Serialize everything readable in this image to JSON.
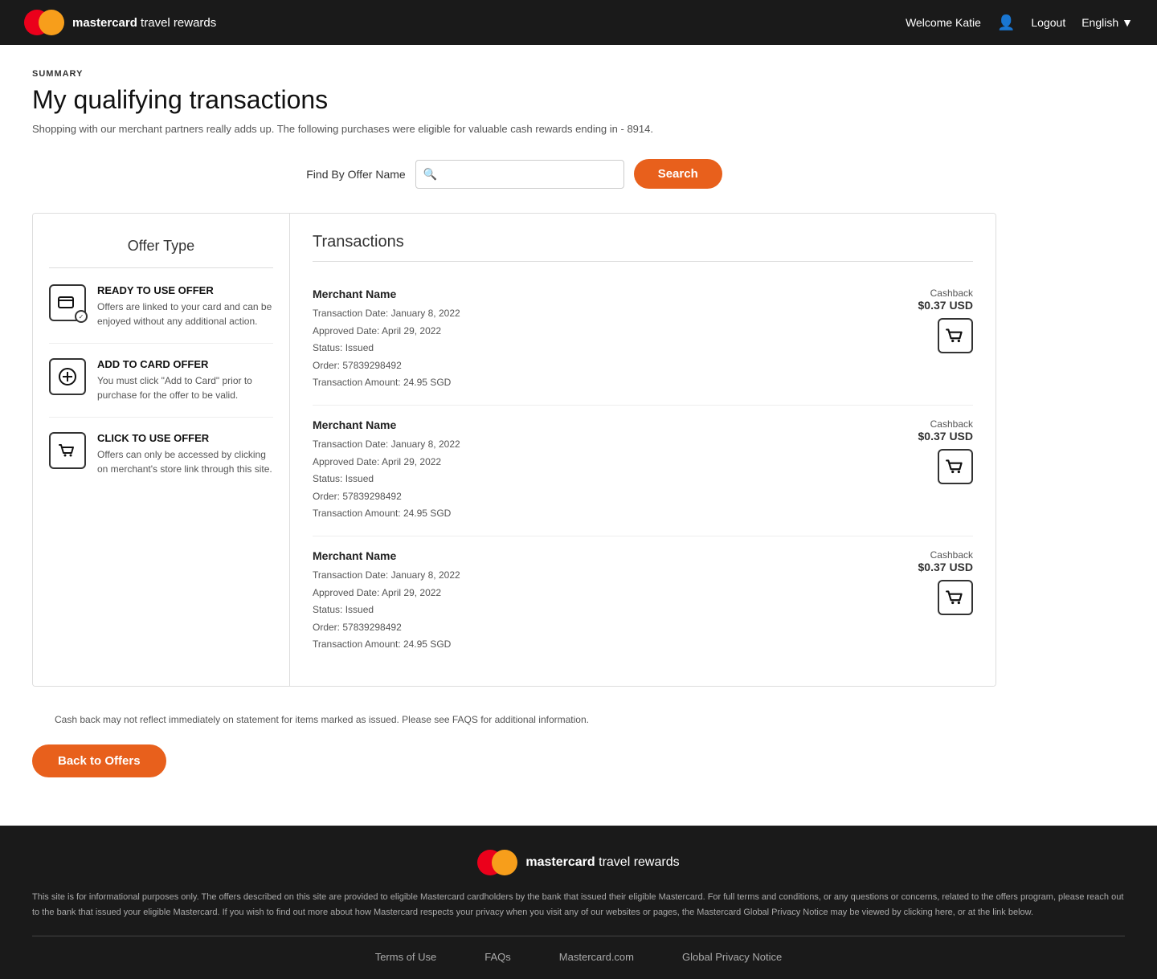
{
  "header": {
    "brand": "mastercard",
    "brand_suffix": " travel rewards",
    "welcome_text": "Welcome Katie",
    "logout_label": "Logout",
    "language_label": "English"
  },
  "page": {
    "summary_label": "SUMMARY",
    "title": "My qualifying transactions",
    "subtitle": "Shopping with our merchant partners really adds up. The following purchases were eligible for valuable cash rewards ending in - 8914."
  },
  "search": {
    "label": "Find By Offer Name",
    "placeholder": "",
    "button_label": "Search"
  },
  "offer_types": {
    "title": "Offer Type",
    "items": [
      {
        "name": "READY TO USE OFFER",
        "description": "Offers are linked to your card and can be enjoyed without any additional action.",
        "icon_type": "card-check"
      },
      {
        "name": "ADD TO CARD OFFER",
        "description": "You must click \"Add to Card\" prior to purchase for the offer to be valid.",
        "icon_type": "plus-circle"
      },
      {
        "name": "CLICK TO USE OFFER",
        "description": "Offers can only be accessed by clicking on merchant's store link through this site.",
        "icon_type": "cart"
      }
    ]
  },
  "transactions": {
    "title": "Transactions",
    "items": [
      {
        "merchant": "Merchant Name",
        "transaction_date": "Transaction Date: January 8, 2022",
        "approved_date": "Approved Date: April 29, 2022",
        "status": "Status: Issued",
        "order": "Order: 57839298492",
        "amount": "Transaction Amount: 24.95 SGD",
        "cashback_label": "Cashback",
        "cashback_amount": "$0.37 USD"
      },
      {
        "merchant": "Merchant Name",
        "transaction_date": "Transaction Date: January 8, 2022",
        "approved_date": "Approved Date: April 29, 2022",
        "status": "Status: Issued",
        "order": "Order: 57839298492",
        "amount": "Transaction Amount: 24.95 SGD",
        "cashback_label": "Cashback",
        "cashback_amount": "$0.37 USD"
      },
      {
        "merchant": "Merchant Name",
        "transaction_date": "Transaction Date: January 8, 2022",
        "approved_date": "Approved Date: April 29, 2022",
        "status": "Status: Issued",
        "order": "Order: 57839298492",
        "amount": "Transaction Amount: 24.95 SGD",
        "cashback_label": "Cashback",
        "cashback_amount": "$0.37 USD"
      }
    ],
    "cashback_note": "Cash back may not reflect immediately on statement for items marked as issued. Please see FAQS for additional information.",
    "back_button_label": "Back to Offers"
  },
  "footer": {
    "brand": "mastercard",
    "brand_suffix": " travel rewards",
    "disclaimer": "This site is for informational purposes only. The offers described on this site are provided to eligible Mastercard cardholders by the bank that issued their eligible Mastercard. For full terms and conditions, or any questions or concerns, related to the offers program, please reach out to the bank that issued your eligible Mastercard. If you wish to find out more about how Mastercard respects your privacy when you visit any of our websites or pages, the Mastercard Global Privacy Notice may be viewed by clicking here, or at the link below.",
    "links": [
      {
        "label": "Terms of Use"
      },
      {
        "label": "FAQs"
      },
      {
        "label": "Mastercard.com"
      },
      {
        "label": "Global Privacy Notice"
      }
    ]
  }
}
